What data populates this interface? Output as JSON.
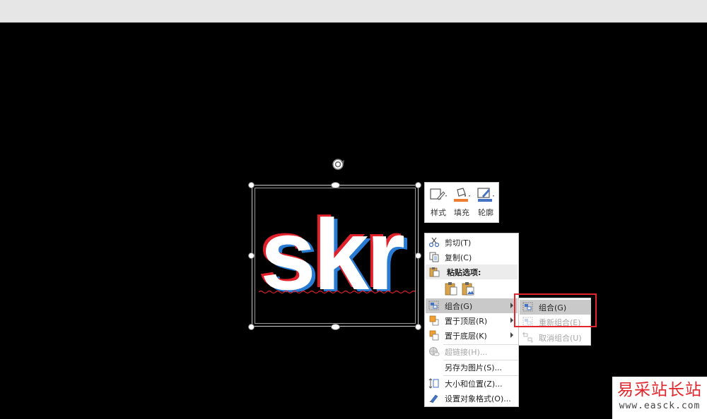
{
  "slide": {
    "art_text": "skr",
    "text_colors": {
      "fill": "#ffffff",
      "left_shadow": "#e0202b",
      "right_shadow": "#2a7bd4"
    }
  },
  "mini_toolbar": {
    "buttons": [
      {
        "label": "样式",
        "icon": "shape-style-icon"
      },
      {
        "label": "填充",
        "icon": "fill-bucket-icon",
        "color": "#ed7d31"
      },
      {
        "label": "轮廓",
        "icon": "outline-pen-icon",
        "color": "#4472c4"
      }
    ]
  },
  "context_menu": {
    "cut": "剪切(T)",
    "copy": "复制(C)",
    "paste_options_header": "粘贴选项:",
    "group": "组合(G)",
    "bring_to_front": "置于顶层(R)",
    "send_to_back": "置于底层(K)",
    "hyperlink": "超链接(H)...",
    "save_as_picture": "另存为图片(S)...",
    "size_position": "大小和位置(Z)...",
    "format_object": "设置对象格式(O)..."
  },
  "submenu": {
    "group": "组合(G)",
    "regroup": "重新组合(E)",
    "ungroup": "取消组合(U)"
  },
  "watermark": {
    "title": "易采站长站",
    "url": "www.easck.com"
  },
  "highlight_color": "#e1272d"
}
